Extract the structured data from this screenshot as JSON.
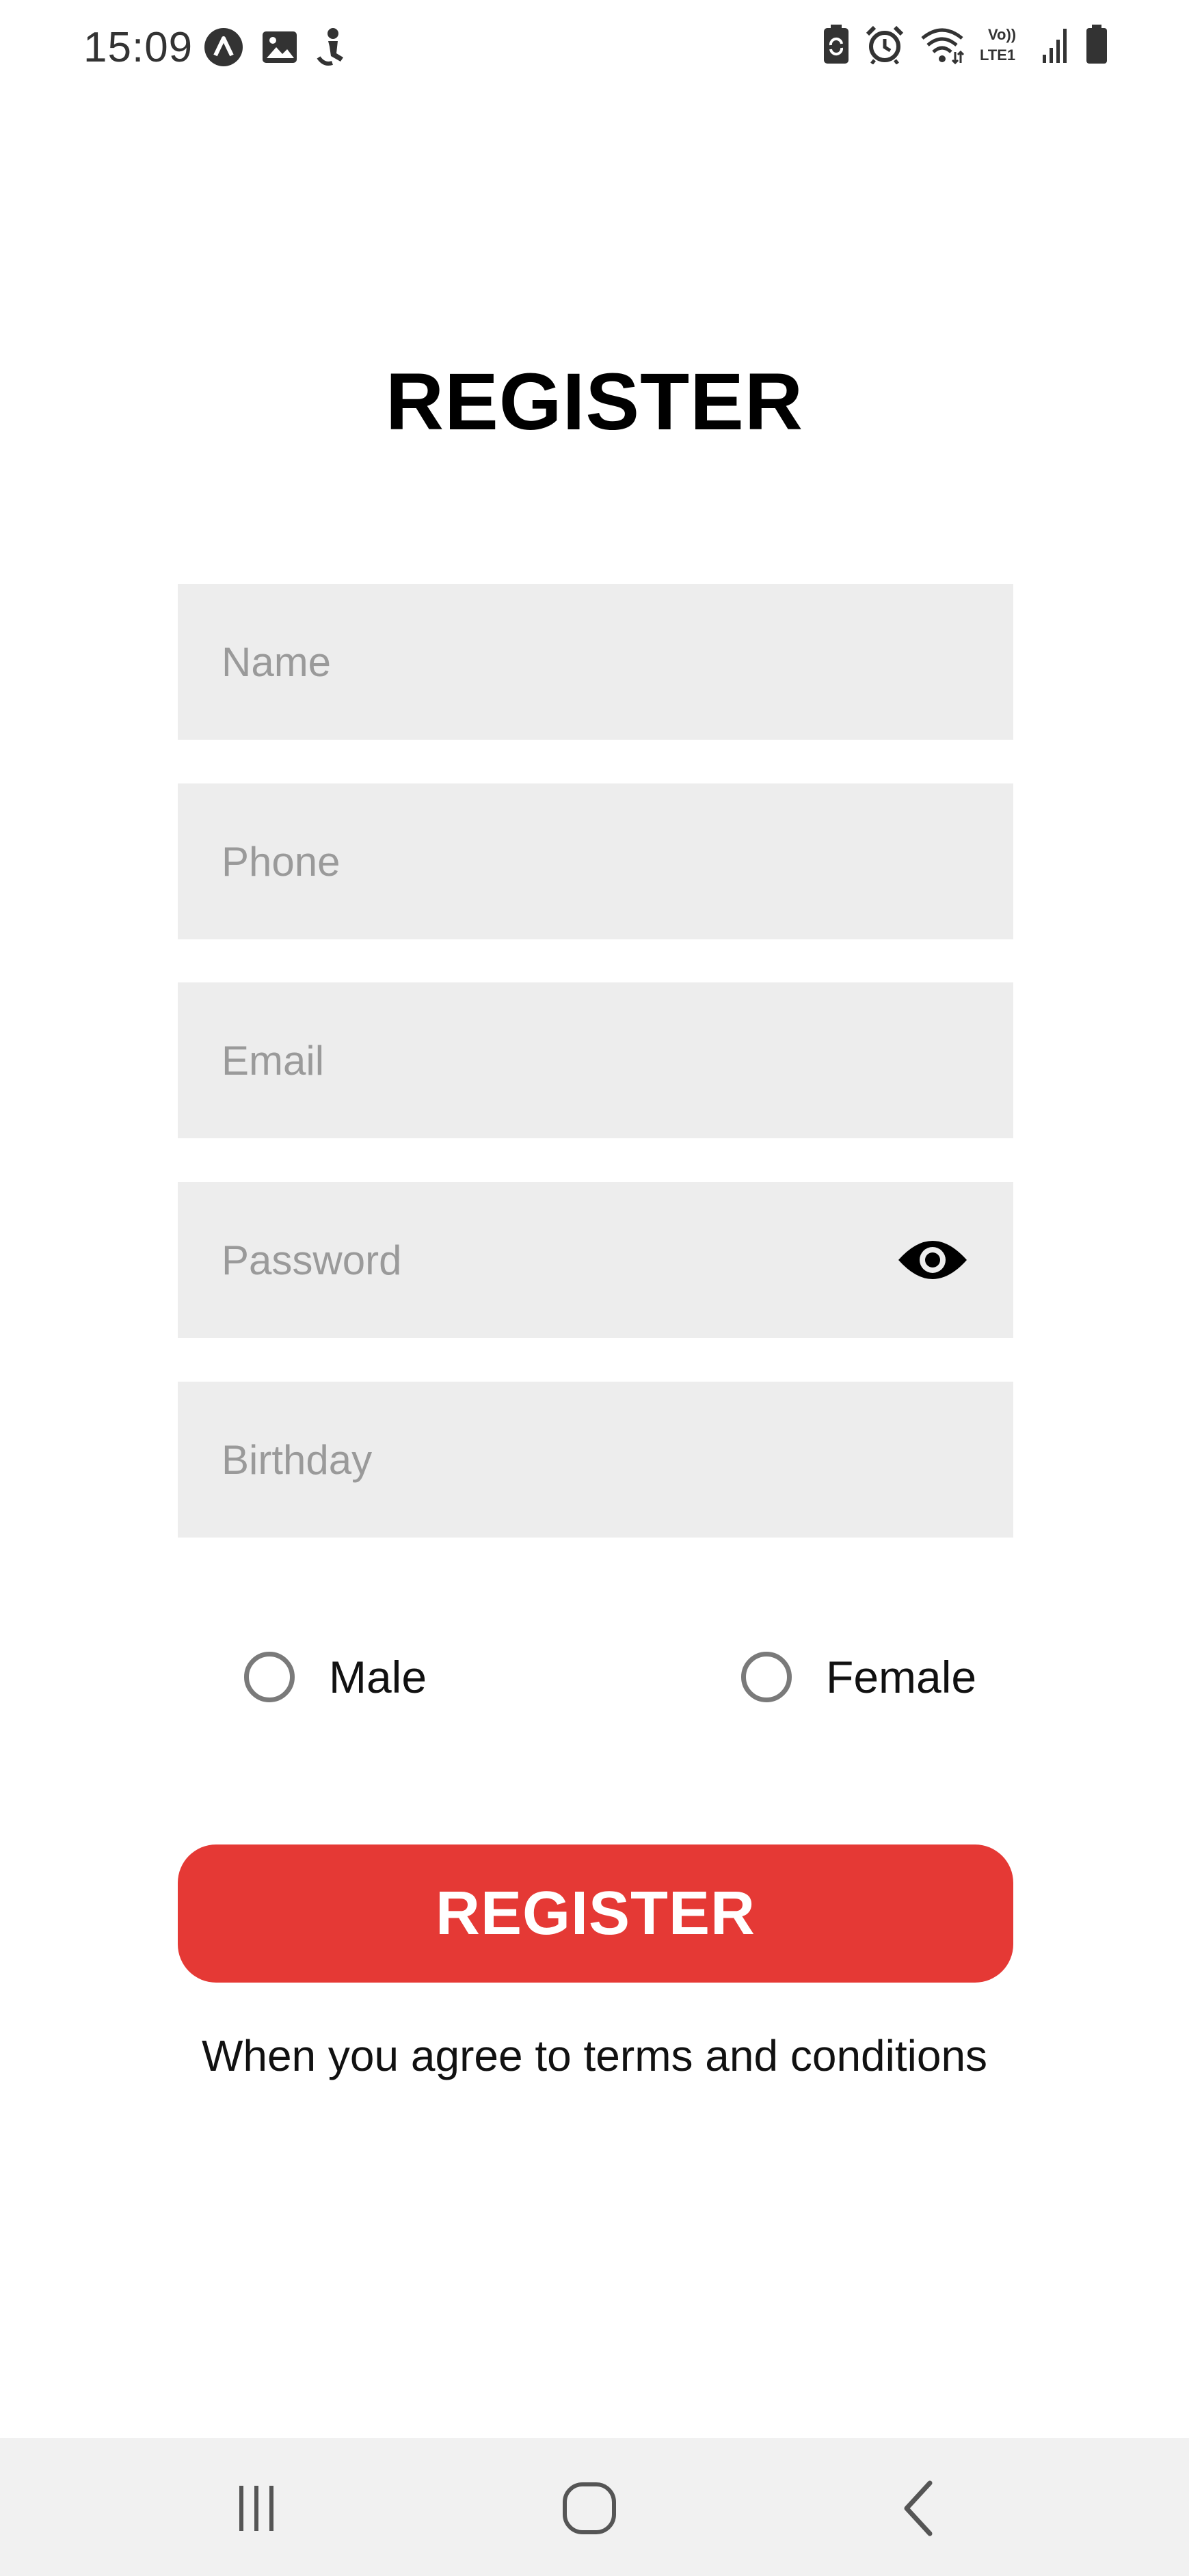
{
  "status_bar": {
    "time": "15:09",
    "left_icons": [
      "app-a-icon",
      "image-icon",
      "person-icon"
    ],
    "right_icons": [
      "battery-saver-icon",
      "alarm-icon",
      "wifi-icon",
      "volte-lte1-icon",
      "signal-icon",
      "battery-icon"
    ]
  },
  "form": {
    "title": "REGISTER",
    "fields": {
      "name": {
        "value": "",
        "placeholder": "Name"
      },
      "phone": {
        "value": "",
        "placeholder": "Phone"
      },
      "email": {
        "value": "",
        "placeholder": "Email"
      },
      "password": {
        "value": "",
        "placeholder": "Password"
      },
      "birthday": {
        "value": "",
        "placeholder": "Birthday"
      }
    },
    "password_toggle_icon": "eye-icon",
    "gender_options": [
      {
        "label": "Male",
        "selected": false
      },
      {
        "label": "Female",
        "selected": false
      }
    ],
    "submit_label": "REGISTER",
    "terms_text": "When you agree to terms and conditions"
  },
  "colors": {
    "accent": "#e53935",
    "field_background": "#ededed",
    "placeholder": "#9a9a9a",
    "nav_background": "#f1f1f1"
  },
  "nav_bar": {
    "buttons": [
      "recent-apps-icon",
      "home-icon",
      "back-icon"
    ]
  }
}
